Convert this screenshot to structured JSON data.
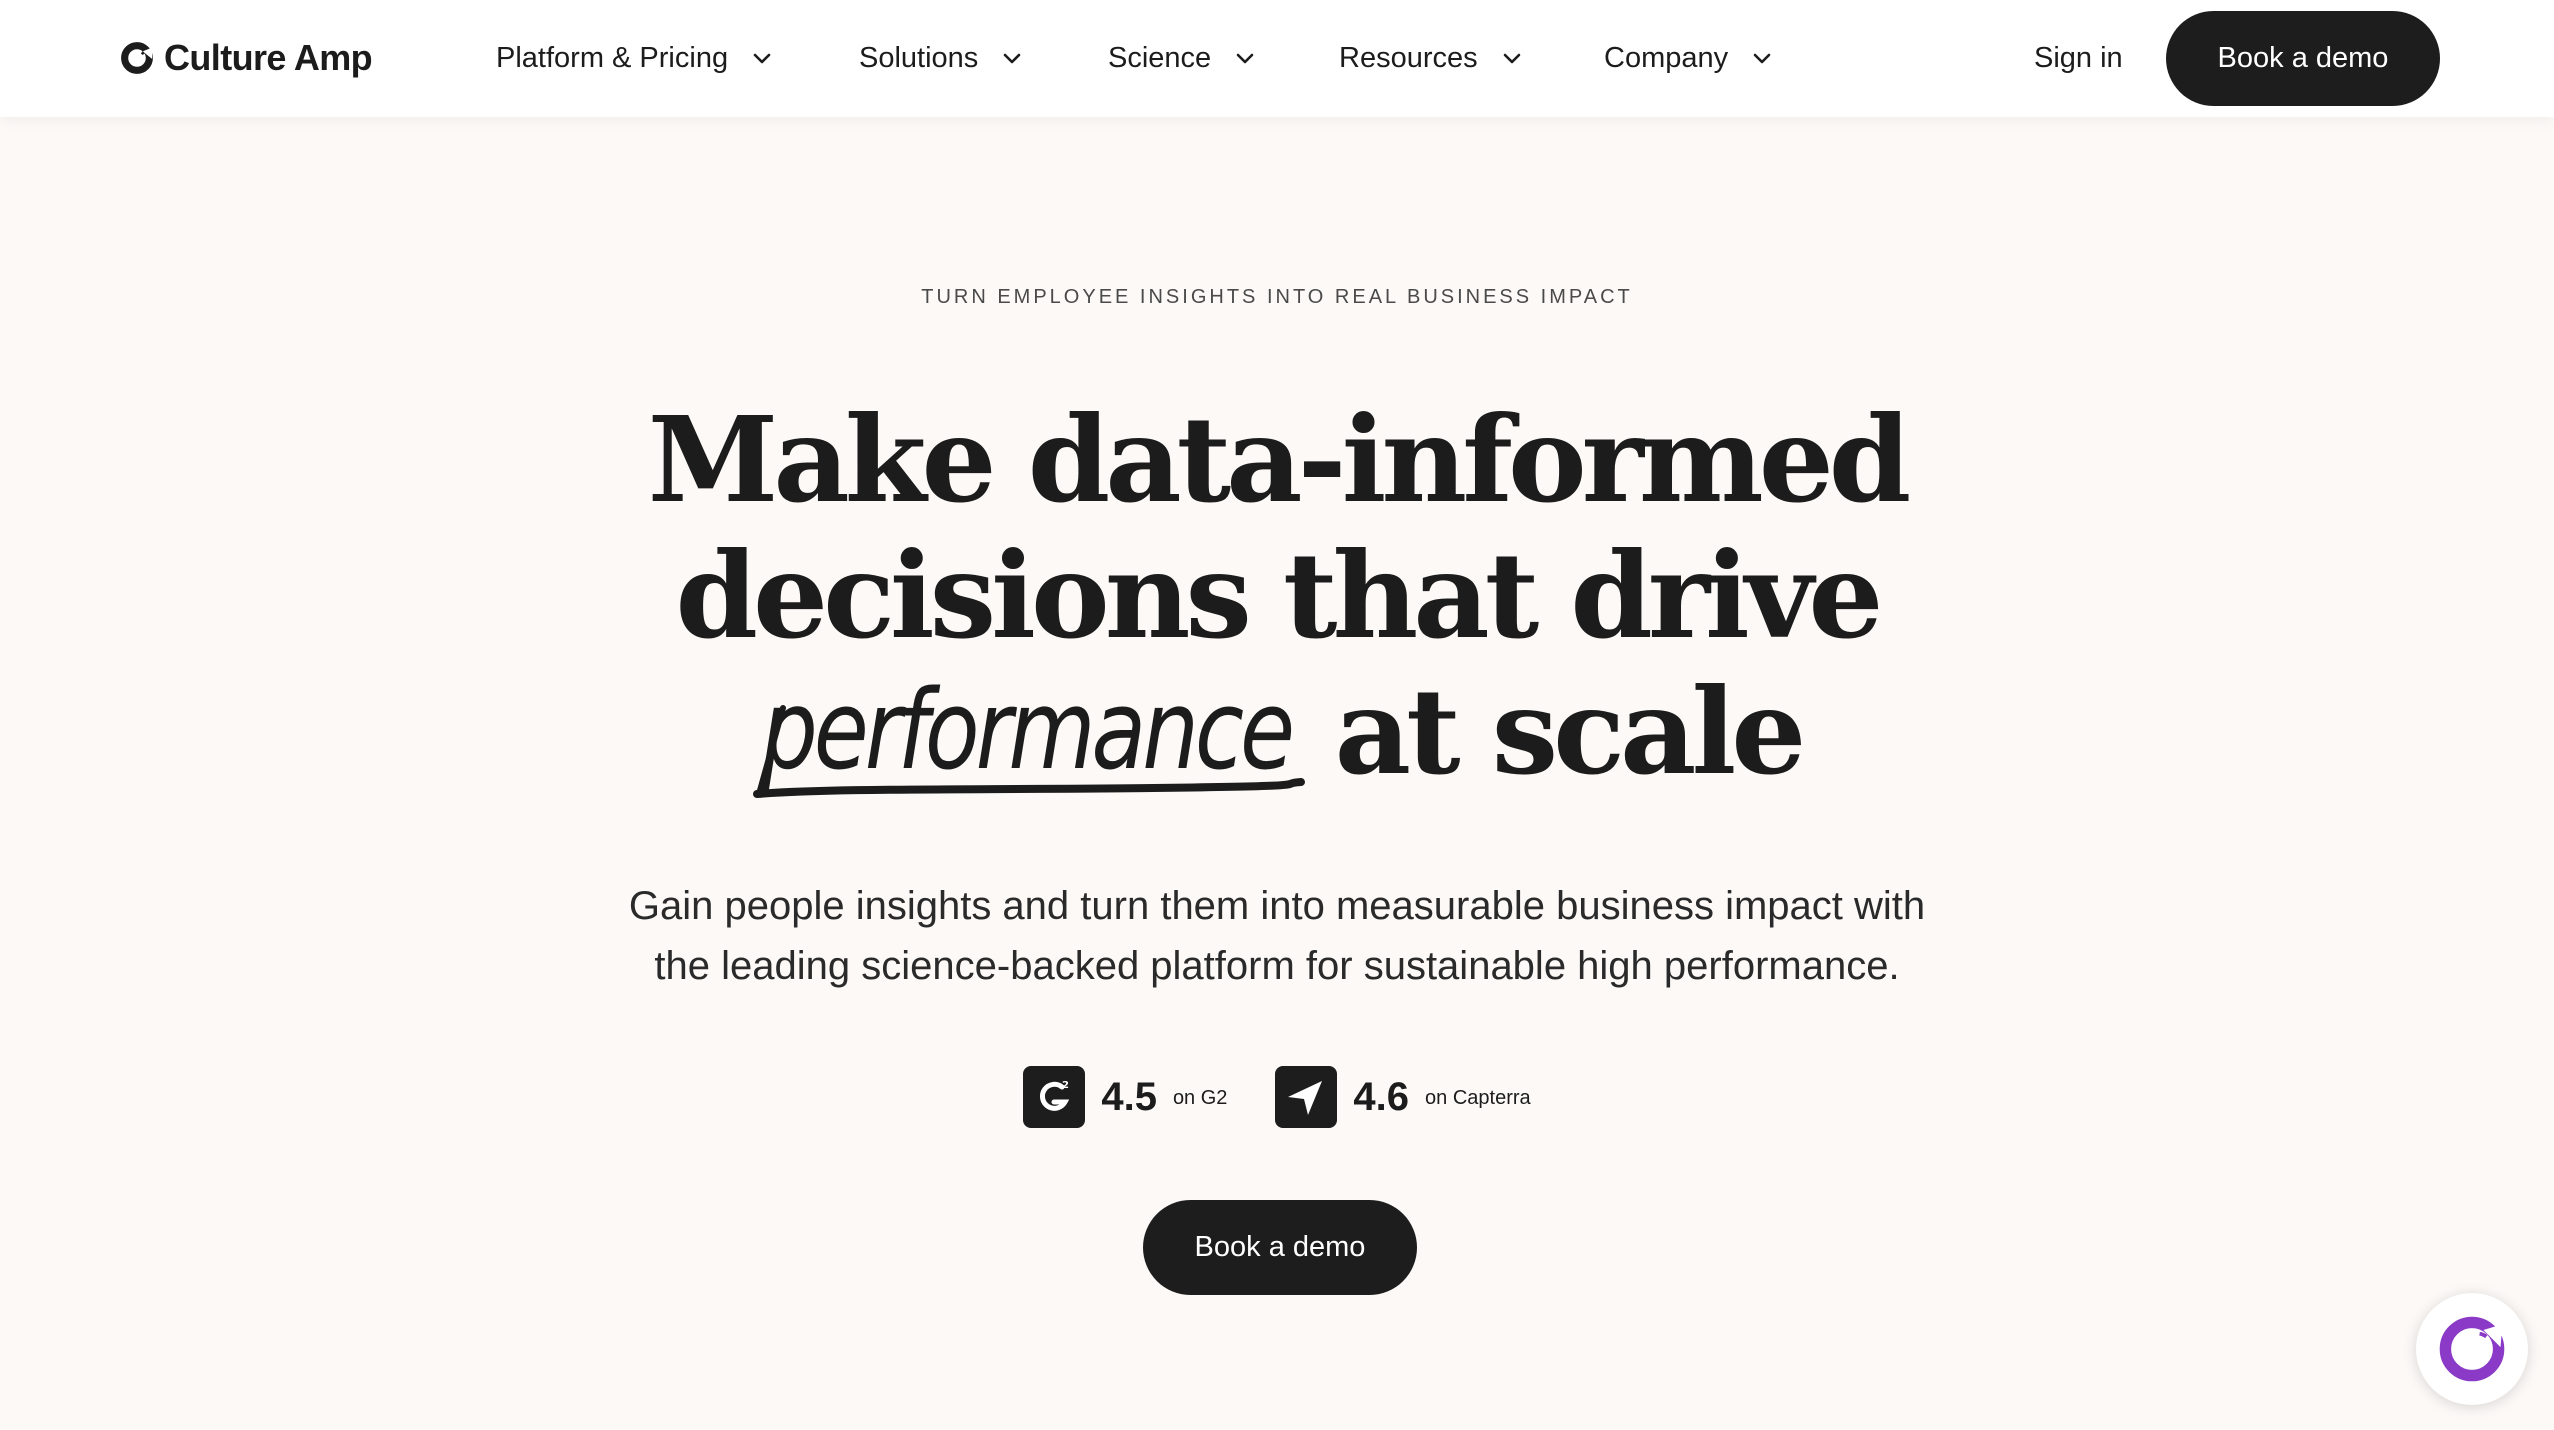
{
  "brand": {
    "name": "Culture Amp",
    "accent": "#8a3ac6",
    "dark": "#1d1d1d",
    "background": "#fcf9f7"
  },
  "nav": {
    "items": [
      {
        "label": "Platform & Pricing",
        "icon": "chevron-down-icon"
      },
      {
        "label": "Solutions",
        "icon": "chevron-down-icon"
      },
      {
        "label": "Science",
        "icon": "chevron-down-icon"
      },
      {
        "label": "Resources",
        "icon": "chevron-down-icon"
      },
      {
        "label": "Company",
        "icon": "chevron-down-icon"
      }
    ],
    "sign_in": "Sign in",
    "cta": "Book a demo"
  },
  "hero": {
    "eyebrow": "TURN EMPLOYEE INSIGHTS INTO REAL BUSINESS IMPACT",
    "headline_line1": "Make data-informed",
    "headline_line2": "decisions that drive",
    "headline_script": "performance",
    "headline_line3_end": "at scale",
    "subtitle_line1": "Gain people insights and turn them into measurable business impact with",
    "subtitle_line2": "the leading science-backed platform for sustainable high performance.",
    "ratings": [
      {
        "value": "4.5",
        "source": "on G2",
        "icon": "g2-logo-icon"
      },
      {
        "value": "4.6",
        "source": "on Capterra",
        "icon": "capterra-logo-icon"
      }
    ],
    "cta": "Book a demo"
  },
  "chat": {
    "icon": "culture-amp-chat-icon"
  }
}
